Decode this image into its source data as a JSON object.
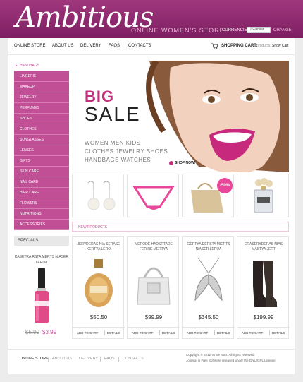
{
  "header": {
    "logo": "Ambitious",
    "tagline": "ONLINE WOMEN'S STORE",
    "currencies_label": "CURRENCIES:",
    "currency_value": "US Dollar",
    "change_label": "CHANGE"
  },
  "nav": {
    "items": [
      "ONLINE STORE",
      "ABOUT US",
      "DELIVERY",
      "FAQS",
      "CONTACTS"
    ],
    "cart_label": "SHOPPING CART:",
    "cart_count": "3 products",
    "cart_show": "Show Cart"
  },
  "sidebar": {
    "items": [
      "HANDBAGS",
      "LINGERIE",
      "MAKEUP",
      "JEWELRY",
      "PERFUMES",
      "SHOES",
      "CLOTHES",
      "SUNGLASSES",
      "LENSES",
      "GIFTS",
      "SKIN CARE",
      "NAIL CARE",
      "HAIR CARE",
      "FLOWERS",
      "NUTRITIONS",
      "ACCESSORIES"
    ]
  },
  "specials": {
    "heading": "SPECIALS",
    "product_name": "KASETRA RSTA MERTS NIASER LERUA",
    "old_price": "$5.99",
    "new_price": "$3.99"
  },
  "banner": {
    "big": "BIG",
    "sale": "SALE",
    "row1": "WOMEN     MEN     KIDS",
    "row2": "CLOTHES   JEWELRY   SHOES",
    "row3": "HANDBAGS   WATCHES",
    "shop_now": "SHOP NOW!"
  },
  "thumbs": {
    "badge": "-50%"
  },
  "new_products": {
    "heading": "NEW PRODUCTS",
    "items": [
      {
        "name": "JERYDERAS NIA SERASE KERTYA LERO",
        "price": "$50.50",
        "add": "ADD TO CART",
        "details": "DETAILS"
      },
      {
        "name": "MERODE HADSRTADE FERIRE MERTYA",
        "price": "$99.99",
        "add": "ADD TO CART",
        "details": "DETAILS"
      },
      {
        "name": "GERTYA DERSTA MIERTS NIASER LERUA",
        "price": "$345.50",
        "add": "ADD TO CART",
        "details": "DETAILS"
      },
      {
        "name": "ERASERYDERAS NIAS MASTYA JERT",
        "price": "$199.99",
        "add": "ADD TO CART",
        "details": "DETAILS"
      }
    ]
  },
  "footer": {
    "items": [
      "ONLINE STORE",
      "ABOUT US",
      "DELIVERY",
      "FAQS",
      "CONTACTS"
    ],
    "copyright": "Copyright © 2012 Virtue Mart. All rights reserved.",
    "powered": "Joomla! is Free Software released under the GNU/GPL License."
  },
  "colors": {
    "brand": "#a0377d",
    "accent": "#c14f96"
  }
}
